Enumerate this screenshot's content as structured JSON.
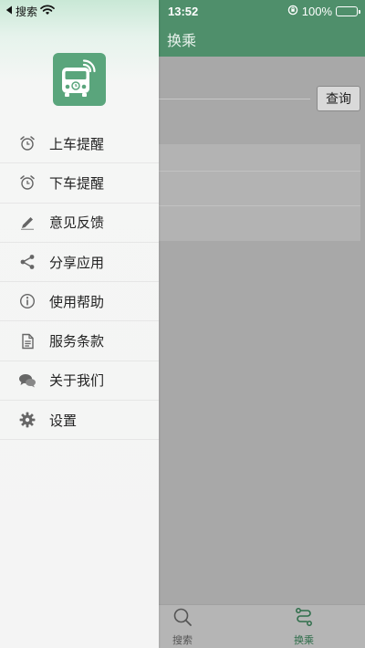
{
  "status_bar": {
    "back_app": "搜索",
    "time": "13:52",
    "battery": "100%"
  },
  "app": {
    "title": "换乘",
    "query_button": "查询",
    "tabs": [
      {
        "label": "搜索",
        "icon": "search-icon",
        "active": false
      },
      {
        "label": "换乘",
        "icon": "transfer-route-icon",
        "active": true
      }
    ],
    "accent_color": "#4f8f6b"
  },
  "drawer": {
    "logo_icon": "bus-alarm-logo-icon",
    "items": [
      {
        "label": "上车提醒",
        "icon": "alarm-clock-icon"
      },
      {
        "label": "下车提醒",
        "icon": "alarm-clock-icon"
      },
      {
        "label": "意见反馈",
        "icon": "pencil-icon"
      },
      {
        "label": "分享应用",
        "icon": "share-icon"
      },
      {
        "label": "使用帮助",
        "icon": "info-icon"
      },
      {
        "label": "服务条款",
        "icon": "document-icon"
      },
      {
        "label": "关于我们",
        "icon": "chat-bubbles-icon"
      },
      {
        "label": "设置",
        "icon": "gear-icon"
      }
    ]
  }
}
